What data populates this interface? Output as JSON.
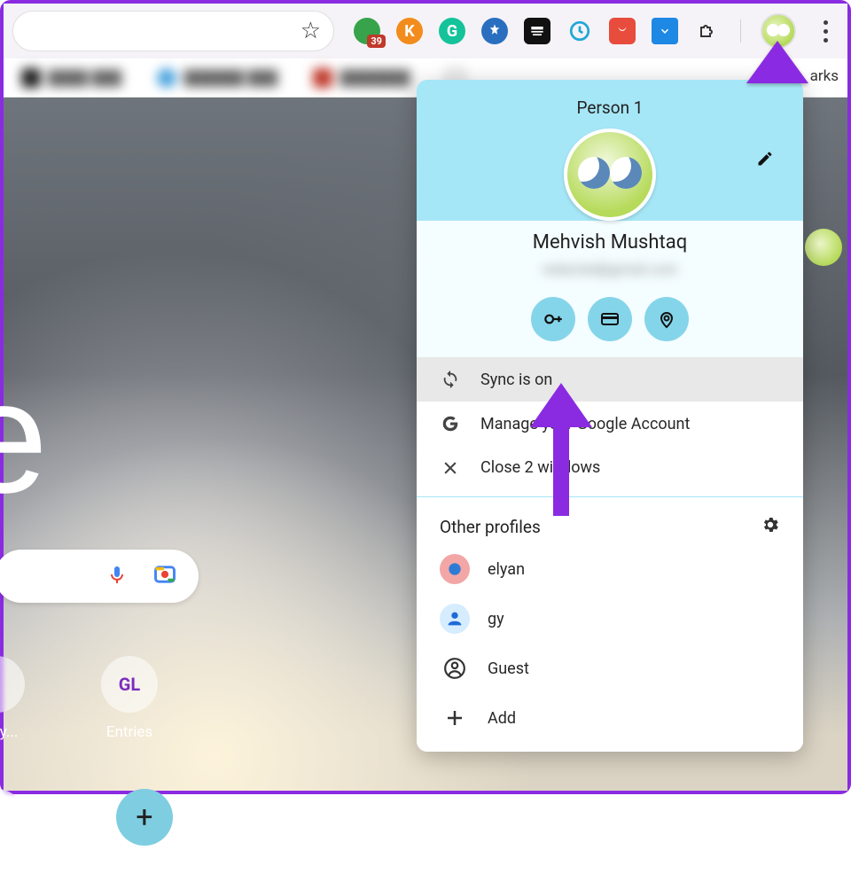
{
  "toolbar": {
    "extensions": [
      {
        "name": "keeper",
        "bg": "#37a34a",
        "badge": "39"
      },
      {
        "name": "kami",
        "bg": "#f28c1c",
        "letter": "K"
      },
      {
        "name": "grammarly",
        "bg": "#15c39a",
        "letter": "G"
      },
      {
        "name": "plus",
        "bg": "#2a6fbf"
      },
      {
        "name": "monkey",
        "bg": "#111111"
      },
      {
        "name": "clockify",
        "bg": "#ffffff"
      },
      {
        "name": "red",
        "bg": "#e74c3c"
      },
      {
        "name": "download",
        "bg": "#1e88e5"
      },
      {
        "name": "puzzle",
        "bg": "transparent"
      }
    ]
  },
  "bookmarks_right": "arks",
  "shortcuts": {
    "s1": "e My...",
    "s2": "Entries",
    "s4": "Add shortcut"
  },
  "panel": {
    "person_label": "Person 1",
    "user_name": "Mehvish Mushtaq",
    "user_email_blurred": "redacted@gmail.com",
    "sync": "Sync is on",
    "manage": "Manage your Google Account",
    "close": "Close 2 windows",
    "other_header": "Other profiles",
    "profiles": [
      {
        "name": "elyan",
        "color": "#f2a6a6"
      },
      {
        "name": "gy",
        "color": "#1e88e5"
      }
    ],
    "guest": "Guest",
    "add": "Add"
  }
}
